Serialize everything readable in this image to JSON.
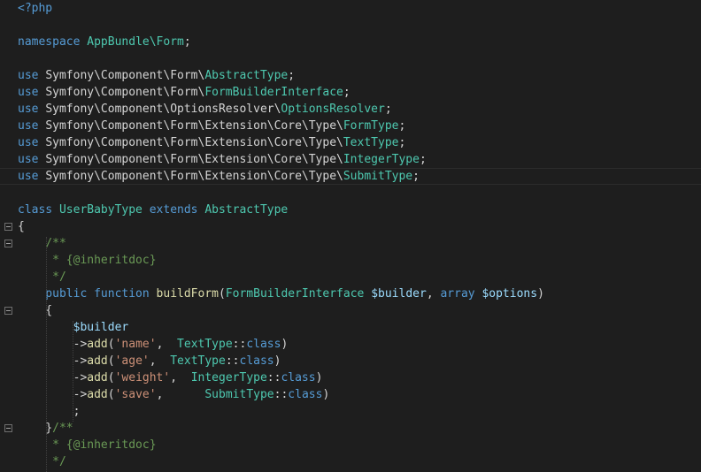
{
  "editor": {
    "language": "php",
    "lines": [
      {
        "tokens": [
          {
            "t": "<?php",
            "c": "tag"
          }
        ]
      },
      {
        "tokens": []
      },
      {
        "tokens": [
          {
            "t": "namespace ",
            "c": "kw"
          },
          {
            "t": "AppBundle\\Form",
            "c": "type"
          },
          {
            "t": ";",
            "c": "punct"
          }
        ]
      },
      {
        "tokens": []
      },
      {
        "tokens": [
          {
            "t": "use ",
            "c": "kw"
          },
          {
            "t": "Symfony\\Component\\Form\\",
            "c": "plain"
          },
          {
            "t": "AbstractType",
            "c": "type"
          },
          {
            "t": ";",
            "c": "punct"
          }
        ]
      },
      {
        "tokens": [
          {
            "t": "use ",
            "c": "kw"
          },
          {
            "t": "Symfony\\Component\\Form\\",
            "c": "plain"
          },
          {
            "t": "FormBuilderInterface",
            "c": "type"
          },
          {
            "t": ";",
            "c": "punct"
          }
        ]
      },
      {
        "tokens": [
          {
            "t": "use ",
            "c": "kw"
          },
          {
            "t": "Symfony\\Component\\OptionsResolver\\",
            "c": "plain"
          },
          {
            "t": "OptionsResolver",
            "c": "type"
          },
          {
            "t": ";",
            "c": "punct"
          }
        ]
      },
      {
        "tokens": [
          {
            "t": "use ",
            "c": "kw"
          },
          {
            "t": "Symfony\\Component\\Form\\Extension\\Core\\Type\\",
            "c": "plain"
          },
          {
            "t": "FormType",
            "c": "type"
          },
          {
            "t": ";",
            "c": "punct"
          }
        ]
      },
      {
        "tokens": [
          {
            "t": "use ",
            "c": "kw"
          },
          {
            "t": "Symfony\\Component\\Form\\Extension\\Core\\Type\\",
            "c": "plain"
          },
          {
            "t": "TextType",
            "c": "type"
          },
          {
            "t": ";",
            "c": "punct"
          }
        ]
      },
      {
        "tokens": [
          {
            "t": "use ",
            "c": "kw"
          },
          {
            "t": "Symfony\\Component\\Form\\Extension\\Core\\Type\\",
            "c": "plain"
          },
          {
            "t": "IntegerType",
            "c": "type"
          },
          {
            "t": ";",
            "c": "punct"
          }
        ]
      },
      {
        "current": true,
        "tokens": [
          {
            "t": "use ",
            "c": "kw"
          },
          {
            "t": "Symfony\\Component\\Form\\Extension\\Core\\Type\\",
            "c": "plain"
          },
          {
            "t": "SubmitType",
            "c": "type"
          },
          {
            "t": ";",
            "c": "punct"
          }
        ]
      },
      {
        "tokens": []
      },
      {
        "tokens": [
          {
            "t": "class ",
            "c": "kw"
          },
          {
            "t": "UserBabyType",
            "c": "type"
          },
          {
            "t": " extends ",
            "c": "kw"
          },
          {
            "t": "AbstractType",
            "c": "type"
          }
        ]
      },
      {
        "fold": true,
        "tokens": [
          {
            "t": "{",
            "c": "punct"
          }
        ]
      },
      {
        "fold": true,
        "tokens": [
          {
            "t": "    /**",
            "c": "comment"
          }
        ]
      },
      {
        "tokens": [
          {
            "t": "     * {@inheritdoc}",
            "c": "comment"
          }
        ]
      },
      {
        "tokens": [
          {
            "t": "     */",
            "c": "comment"
          }
        ]
      },
      {
        "tokens": [
          {
            "t": "    public ",
            "c": "kw"
          },
          {
            "t": "function ",
            "c": "kw"
          },
          {
            "t": "buildForm",
            "c": "fn"
          },
          {
            "t": "(",
            "c": "punct"
          },
          {
            "t": "FormBuilderInterface",
            "c": "type"
          },
          {
            "t": " ",
            "c": "plain"
          },
          {
            "t": "$builder",
            "c": "var"
          },
          {
            "t": ", ",
            "c": "punct"
          },
          {
            "t": "array",
            "c": "kw"
          },
          {
            "t": " ",
            "c": "plain"
          },
          {
            "t": "$options",
            "c": "var"
          },
          {
            "t": ")",
            "c": "punct"
          }
        ]
      },
      {
        "fold": true,
        "tokens": [
          {
            "t": "    {",
            "c": "punct"
          }
        ]
      },
      {
        "tokens": [
          {
            "t": "        ",
            "c": "plain"
          },
          {
            "t": "$builder",
            "c": "var"
          }
        ]
      },
      {
        "tokens": [
          {
            "t": "        ->",
            "c": "punct"
          },
          {
            "t": "add",
            "c": "fn"
          },
          {
            "t": "(",
            "c": "punct"
          },
          {
            "t": "'name'",
            "c": "str"
          },
          {
            "t": ",  ",
            "c": "punct"
          },
          {
            "t": "TextType",
            "c": "type"
          },
          {
            "t": "::",
            "c": "punct"
          },
          {
            "t": "class",
            "c": "kw"
          },
          {
            "t": ")",
            "c": "punct"
          }
        ]
      },
      {
        "tokens": [
          {
            "t": "        ->",
            "c": "punct"
          },
          {
            "t": "add",
            "c": "fn"
          },
          {
            "t": "(",
            "c": "punct"
          },
          {
            "t": "'age'",
            "c": "str"
          },
          {
            "t": ",  ",
            "c": "punct"
          },
          {
            "t": "TextType",
            "c": "type"
          },
          {
            "t": "::",
            "c": "punct"
          },
          {
            "t": "class",
            "c": "kw"
          },
          {
            "t": ")",
            "c": "punct"
          }
        ]
      },
      {
        "tokens": [
          {
            "t": "        ->",
            "c": "punct"
          },
          {
            "t": "add",
            "c": "fn"
          },
          {
            "t": "(",
            "c": "punct"
          },
          {
            "t": "'weight'",
            "c": "str"
          },
          {
            "t": ",  ",
            "c": "punct"
          },
          {
            "t": "IntegerType",
            "c": "type"
          },
          {
            "t": "::",
            "c": "punct"
          },
          {
            "t": "class",
            "c": "kw"
          },
          {
            "t": ")",
            "c": "punct"
          }
        ]
      },
      {
        "tokens": [
          {
            "t": "        ->",
            "c": "punct"
          },
          {
            "t": "add",
            "c": "fn"
          },
          {
            "t": "(",
            "c": "punct"
          },
          {
            "t": "'save'",
            "c": "str"
          },
          {
            "t": ",      ",
            "c": "punct"
          },
          {
            "t": "SubmitType",
            "c": "type"
          },
          {
            "t": "::",
            "c": "punct"
          },
          {
            "t": "class",
            "c": "kw"
          },
          {
            "t": ")",
            "c": "punct"
          }
        ]
      },
      {
        "tokens": [
          {
            "t": "        ;",
            "c": "punct"
          }
        ]
      },
      {
        "fold": true,
        "tokens": [
          {
            "t": "    }",
            "c": "punct"
          },
          {
            "t": "/**",
            "c": "comment"
          }
        ]
      },
      {
        "tokens": [
          {
            "t": "     * {@inheritdoc}",
            "c": "comment"
          }
        ]
      },
      {
        "tokens": [
          {
            "t": "     */",
            "c": "comment"
          }
        ]
      }
    ]
  }
}
